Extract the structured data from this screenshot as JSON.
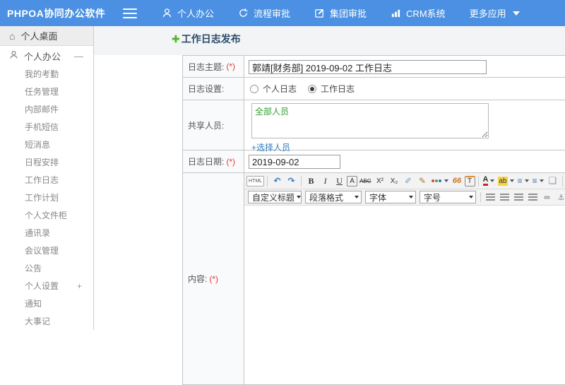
{
  "colors": {
    "topbar_blue": "#4b90e2",
    "title_navy": "#2b4a6b",
    "plus_green": "#54b32b",
    "link_blue": "#2f7cc0",
    "required_red": "#e83a3a",
    "share_text_green": "#2e9e2e"
  },
  "topbar": {
    "brand": "PHPOA协同办公软件",
    "nav": [
      {
        "icon": "person-icon",
        "label": "个人办公"
      },
      {
        "icon": "flow-arrow-icon",
        "label": "流程审批"
      },
      {
        "icon": "edit-square-icon",
        "label": "集团审批"
      },
      {
        "icon": "bar-chart-icon",
        "label": "CRM系统"
      },
      {
        "icon": "none",
        "label": "更多应用"
      }
    ]
  },
  "sidebar": {
    "desktop": "个人桌面",
    "section": {
      "label": "个人办公",
      "collapse": "—"
    },
    "items": [
      "我的考勤",
      "任务管理",
      "内部邮件",
      "手机短信",
      "短消息",
      "日程安排",
      "工作日志",
      "工作计划",
      "个人文件柜",
      "通讯录",
      "会议管理",
      "公告",
      "个人设置",
      "通知",
      "大事记"
    ],
    "settings_expand": "+"
  },
  "main": {
    "title": "工作日志发布",
    "form": {
      "subject": {
        "label": "日志主题:",
        "required": "(*)",
        "value": "郭靖[财务部] 2019-09-02 工作日志"
      },
      "setting": {
        "label": "日志设置:",
        "options": [
          {
            "label": "个人日志",
            "checked": false
          },
          {
            "label": "工作日志",
            "checked": true
          }
        ]
      },
      "share": {
        "label": "共享人员:",
        "value": "全部人员",
        "link": "+选择人员"
      },
      "date": {
        "label": "日志日期:",
        "required": "(*)",
        "value": "2019-09-02"
      },
      "content": {
        "label": "内容:",
        "required": "(*)"
      }
    }
  },
  "editor": {
    "row1": [
      {
        "name": "html-source-icon",
        "glyph": "HTML"
      },
      {
        "name": "undo-icon",
        "glyph": "↶"
      },
      {
        "name": "redo-icon",
        "glyph": "↷"
      },
      {
        "name": "bold-icon",
        "glyph": "B"
      },
      {
        "name": "italic-icon",
        "glyph": "I"
      },
      {
        "name": "underline-icon",
        "glyph": "U"
      },
      {
        "name": "font-box-icon",
        "glyph": "A"
      },
      {
        "name": "strikethrough-icon",
        "glyph": "ABC"
      },
      {
        "name": "superscript-icon",
        "glyph": "X²"
      },
      {
        "name": "subscript-icon",
        "glyph": "X₂"
      },
      {
        "name": "eraser-icon",
        "glyph": "✐"
      },
      {
        "name": "format-brush-icon",
        "glyph": "✎"
      },
      {
        "name": "color-palette-icon",
        "glyph": ""
      },
      {
        "name": "blockquote-icon",
        "glyph": "66"
      },
      {
        "name": "paste-text-icon",
        "glyph": "T"
      },
      {
        "name": "font-color-icon",
        "glyph": "A"
      },
      {
        "name": "highlight-color-icon",
        "glyph": "ab"
      },
      {
        "name": "ordered-list-icon",
        "glyph": "≡"
      },
      {
        "name": "unordered-list-icon",
        "glyph": "≡"
      },
      {
        "name": "new-page-icon",
        "glyph": "❏"
      },
      {
        "name": "fullscreen-icon",
        "glyph": "▣"
      }
    ],
    "row2_selects": [
      "自定义标题",
      "段落格式",
      "字体",
      "字号"
    ],
    "row2_icons": [
      "align-left-icon",
      "align-center-icon",
      "align-right-icon",
      "align-justify-icon",
      "link-icon",
      "anchor-icon",
      "image-icon",
      "image-upload-icon",
      "media-icon",
      "table-icon"
    ],
    "link_glyph": "∞",
    "anchor_glyph": "⚓",
    "table_glyph": "▦"
  }
}
